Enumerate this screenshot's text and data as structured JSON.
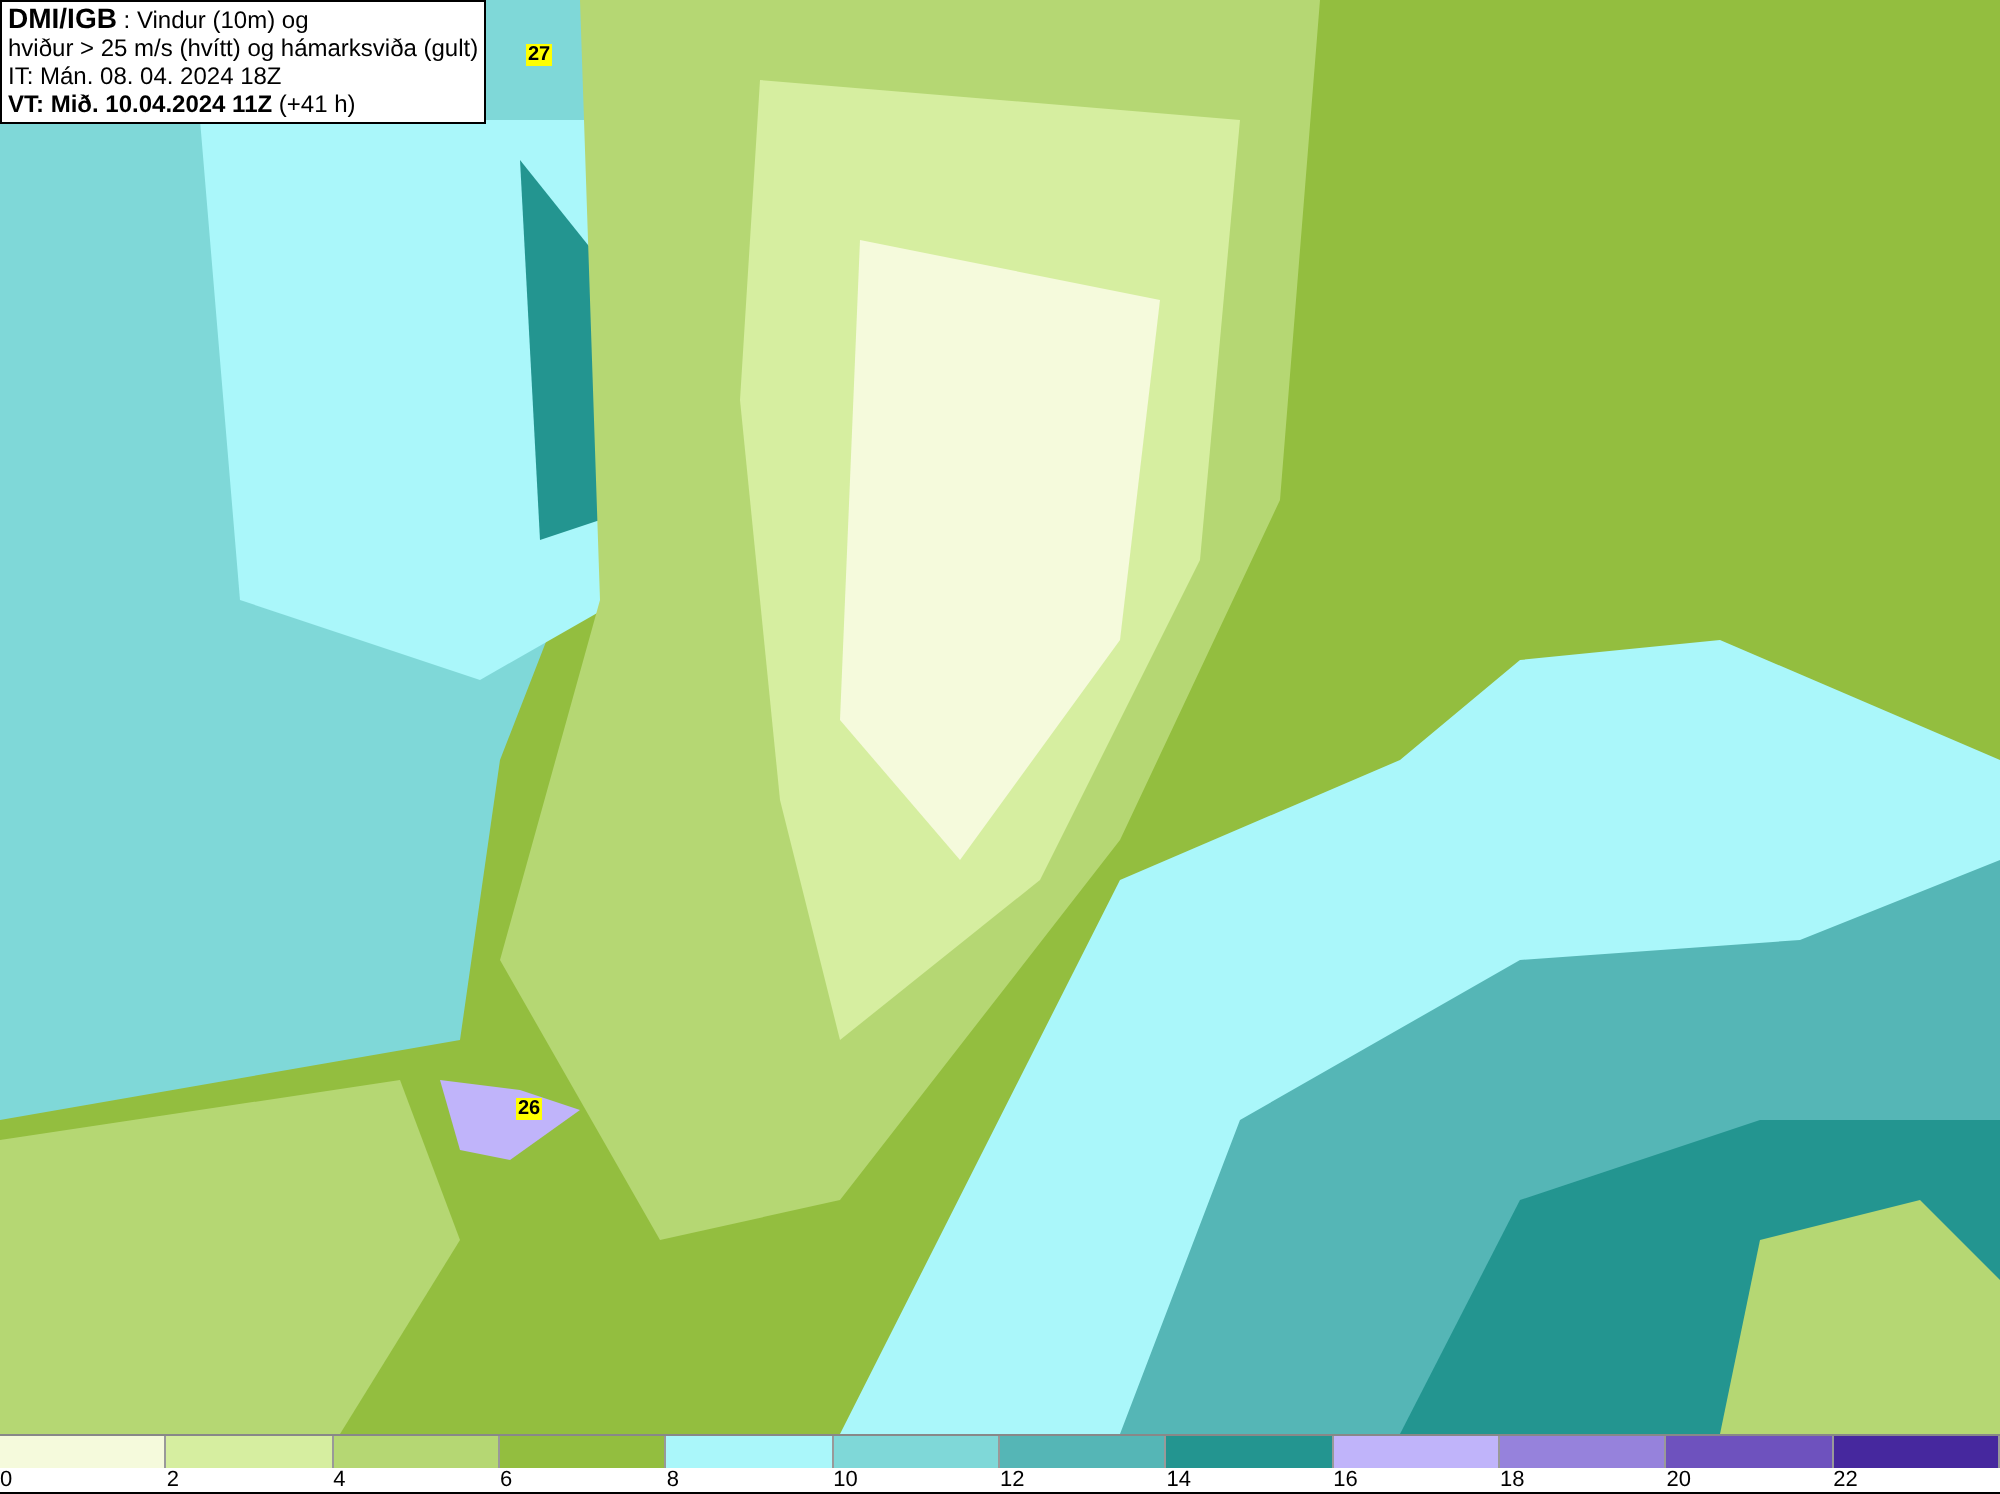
{
  "info_box": {
    "lines": [
      "**DMI/IGB** : Vindur (10m) og",
      "hviður > 25 m/s (hvítt) og hámarksviða (gult)",
      "IT: Mán. 08. 04. 2024 18Z",
      "**VT: Mið. 10.04.2024 11Z** (+41 h)"
    ]
  },
  "map": {
    "markers": [
      {
        "label": "27"
      },
      {
        "label": "26"
      }
    ]
  },
  "legend": {
    "bins": [
      {
        "label": "0",
        "color": "#f5fadc"
      },
      {
        "label": "2",
        "color": "#d6eea0"
      },
      {
        "label": "4",
        "color": "#b5d773"
      },
      {
        "label": "6",
        "color": "#93be3f"
      },
      {
        "label": "8",
        "color": "#aaf7fa"
      },
      {
        "label": "10",
        "color": "#7fd8d8"
      },
      {
        "label": "12",
        "color": "#55b6b6"
      },
      {
        "label": "14",
        "color": "#239590"
      },
      {
        "label": "16",
        "color": "#c0b4fa"
      },
      {
        "label": "18",
        "color": "#9682dc"
      },
      {
        "label": "20",
        "color": "#6e52be"
      },
      {
        "label": "22",
        "color": "#46289e"
      }
    ]
  }
}
